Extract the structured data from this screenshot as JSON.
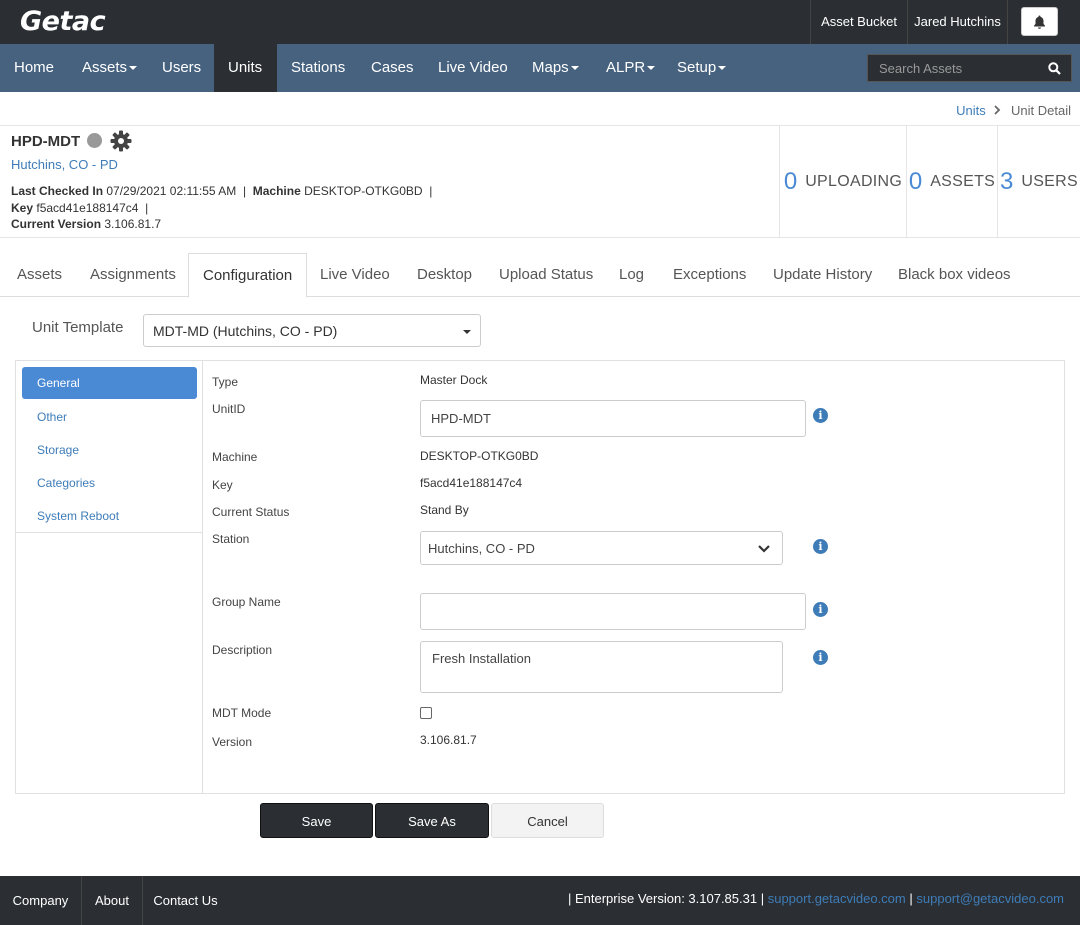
{
  "app": {
    "logo": "Getac"
  },
  "topbar": {
    "asset_bucket": "Asset Bucket",
    "user_name": "Jared Hutchins"
  },
  "nav": {
    "items": [
      {
        "label": "Home"
      },
      {
        "label": "Assets"
      },
      {
        "label": "Users"
      },
      {
        "label": "Units"
      },
      {
        "label": "Stations"
      },
      {
        "label": "Cases"
      },
      {
        "label": "Live Video"
      },
      {
        "label": "Maps"
      },
      {
        "label": "ALPR"
      },
      {
        "label": "Setup"
      }
    ],
    "active": "Units"
  },
  "search": {
    "placeholder": "Search Assets"
  },
  "breadcrumb": {
    "parent": "Units",
    "current": "Unit Detail"
  },
  "unit": {
    "name": "HPD-MDT",
    "station": "Hutchins, CO - PD",
    "last_checked_label": "Last Checked In",
    "last_checked_value": "07/29/2021 02:11:55 AM",
    "machine_label": "Machine",
    "machine_value": "DESKTOP-OTKG0BD",
    "key_label": "Key",
    "key_value": "f5acd41e188147c4",
    "version_label": "Current Version",
    "version_value": "3.106.81.7",
    "separator": "|"
  },
  "stats": [
    {
      "count": "0",
      "label": "UPLOADING"
    },
    {
      "count": "0",
      "label": "ASSETS"
    },
    {
      "count": "3",
      "label": "USERS"
    }
  ],
  "tabs": [
    {
      "label": "Assets"
    },
    {
      "label": "Assignments"
    },
    {
      "label": "Configuration"
    },
    {
      "label": "Live Video"
    },
    {
      "label": "Desktop"
    },
    {
      "label": "Upload Status"
    },
    {
      "label": "Log"
    },
    {
      "label": "Exceptions"
    },
    {
      "label": "Update History"
    },
    {
      "label": "Black box videos"
    }
  ],
  "active_tab": "Configuration",
  "template": {
    "label": "Unit Template",
    "value": "MDT-MD (Hutchins, CO - PD)"
  },
  "sidebar": {
    "items": [
      {
        "label": "General"
      },
      {
        "label": "Other"
      },
      {
        "label": "Storage"
      },
      {
        "label": "Categories"
      },
      {
        "label": "System Reboot"
      }
    ],
    "active": "General"
  },
  "form": {
    "type_label": "Type",
    "type_value": "Master Dock",
    "unitid_label": "UnitID",
    "unitid_value": "HPD-MDT",
    "machine_label": "Machine",
    "machine_value": "DESKTOP-OTKG0BD",
    "key_label": "Key",
    "key_value": "f5acd41e188147c4",
    "status_label": "Current Status",
    "status_value": "Stand By",
    "station_label": "Station",
    "station_value": "Hutchins, CO - PD",
    "group_label": "Group Name",
    "group_value": "",
    "description_label": "Description",
    "description_value": "Fresh Installation",
    "mdt_label": "MDT Mode",
    "mdt_checked": false,
    "version_label": "Version",
    "version_value": "3.106.81.7"
  },
  "buttons": {
    "save": "Save",
    "save_as": "Save As",
    "cancel": "Cancel"
  },
  "footer": {
    "company": "Company",
    "about": "About",
    "contact": "Contact Us",
    "version_text": "| Enterprise Version: 3.107.85.31 |",
    "support_site": "support.getacvideo.com",
    "support_sep": "|",
    "support_email": "support@getacvideo.com"
  },
  "colors": {
    "nav_bg": "#46627f",
    "top_bg": "#2b2f33",
    "accent": "#4a8ad4",
    "link": "#3e7cb8"
  }
}
